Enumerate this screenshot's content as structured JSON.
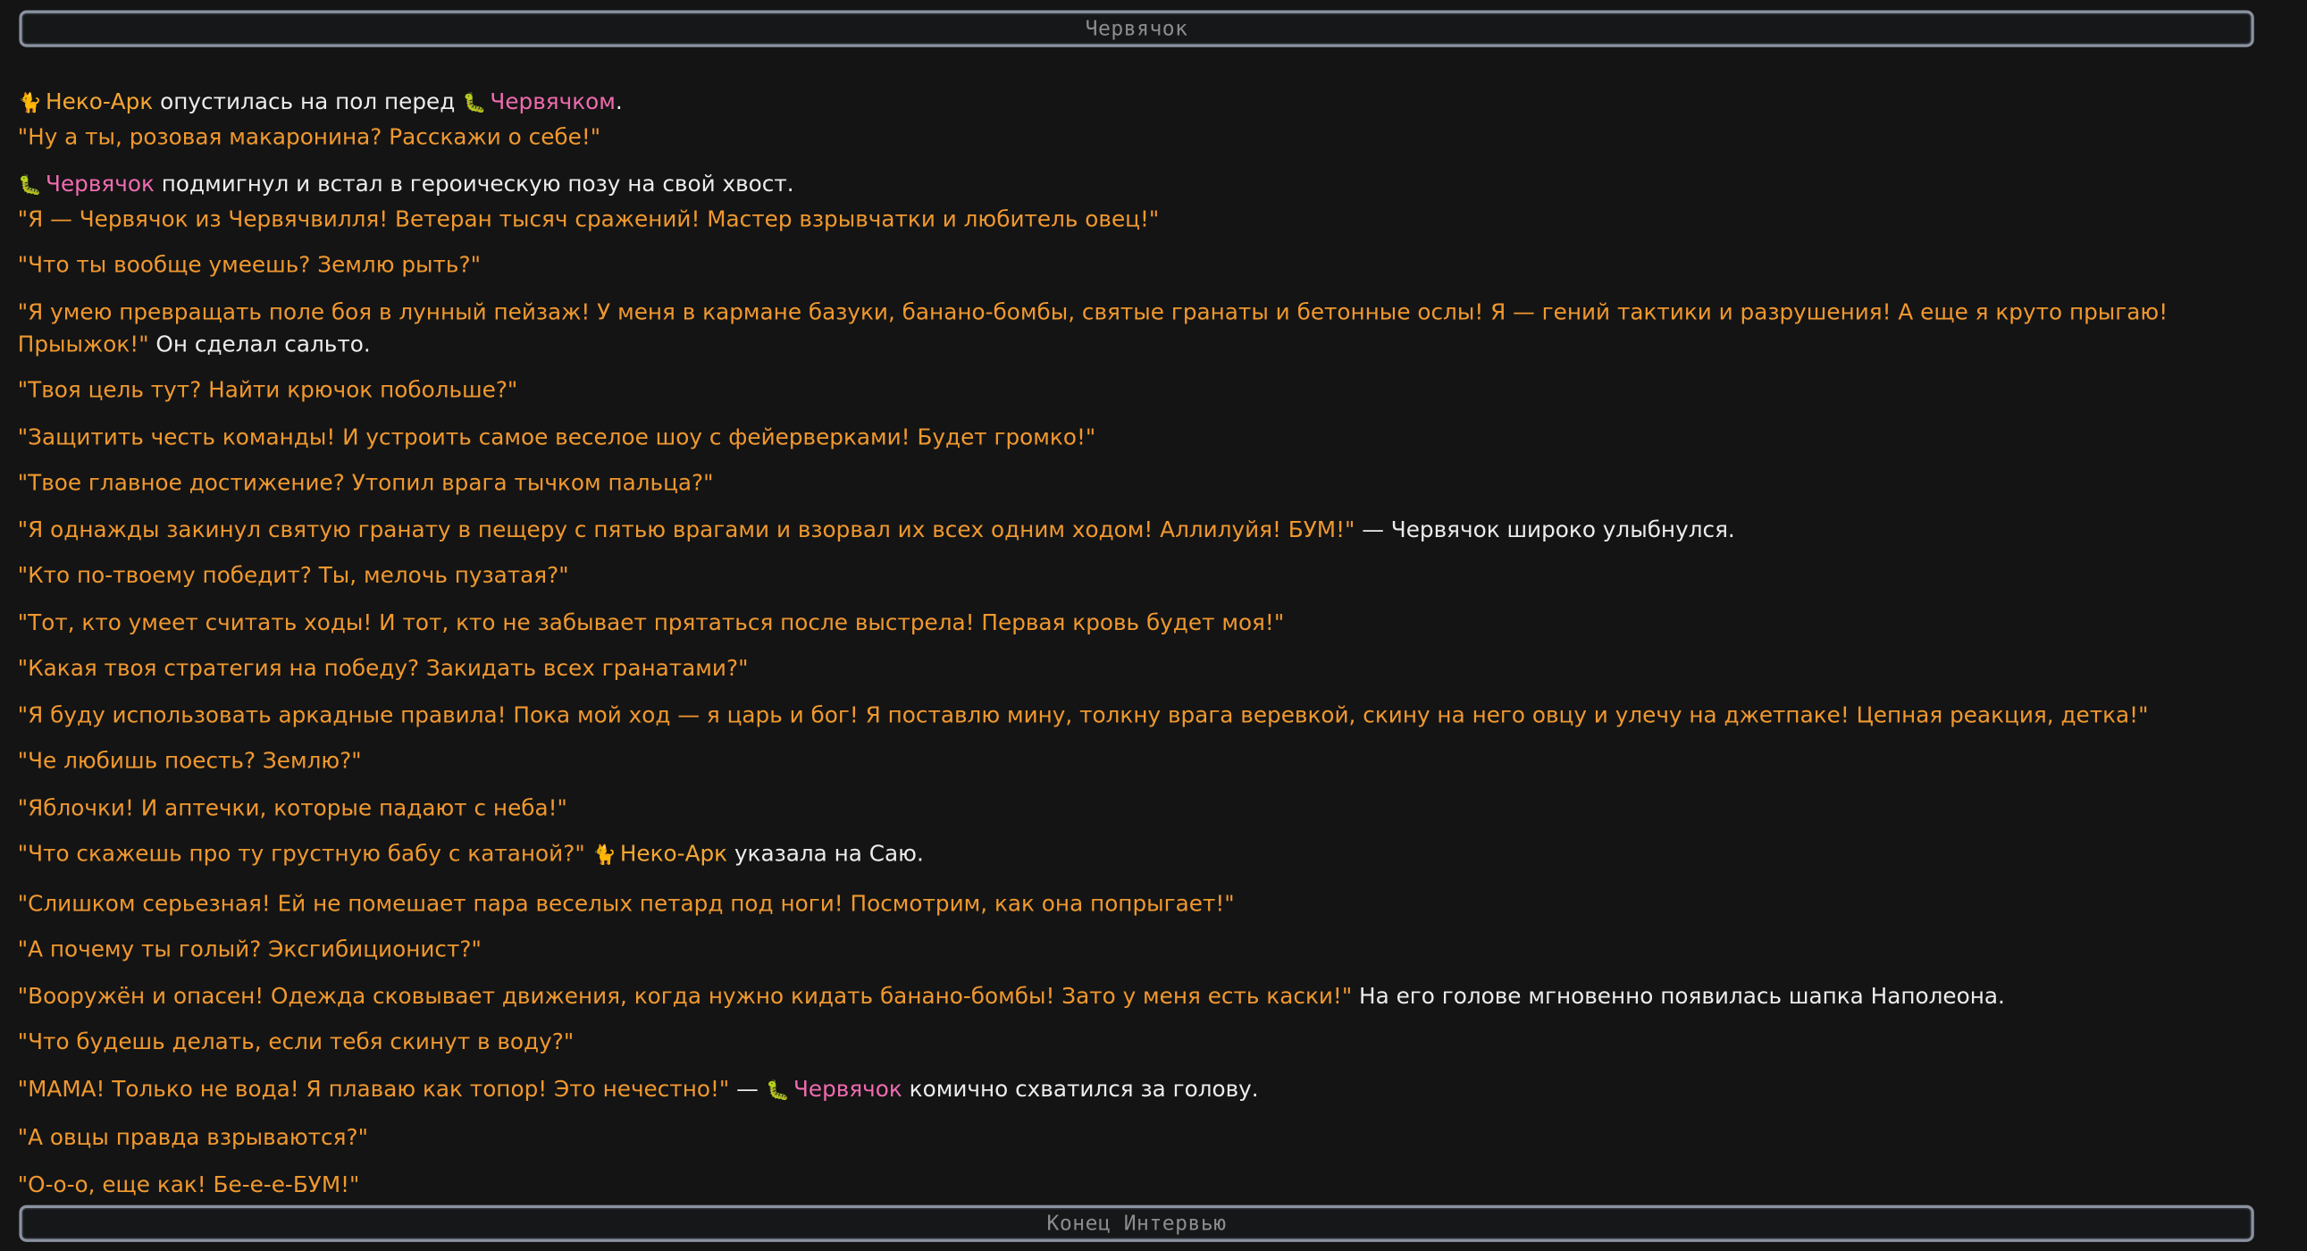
{
  "header": {
    "title": "Червячок"
  },
  "footer": {
    "title": "Конец Интервью"
  },
  "colors": {
    "background": "#141414",
    "quote": "#f0982f",
    "narration": "#ececec",
    "neko_name": "#f5a733",
    "worm_name": "#ef6bb0",
    "banner_border": "#8a92a0"
  },
  "icons": {
    "neko": "cat-icon",
    "worm": "worm-icon"
  },
  "p1": {
    "neko": "Неко-Арк",
    "t1": " опустилась на пол перед ",
    "worm": "Червячком",
    "t2": ".",
    "q1": "\"Ну а ты, розовая макаронина? Расскажи о себе!\""
  },
  "p2": {
    "worm": "Червячок",
    "t1": " подмигнул и встал в героическую позу на свой хвост.",
    "q1": "\"Я — Червячок из Червячвилля! Ветеран тысяч сражений! Мастер взрывчатки и любитель овец!\""
  },
  "p3": {
    "q": "\"Что ты вообще умеешь? Землю рыть?\""
  },
  "p4": {
    "q": "\"Я умею превращать поле боя в лунный пейзаж! У меня в кармане базуки, банано-бомбы, святые гранаты и бетонные ослы! Я — гений тактики и разрушения! А еще я круто прыгаю! Прыыжок!\"",
    "t": " Он сделал сальто."
  },
  "p5": {
    "q": "\"Твоя цель тут? Найти крючок побольше?\""
  },
  "p6": {
    "q": "\"Защитить честь команды! И устроить самое веселое шоу с фейерверками! Будет громко!\""
  },
  "p7": {
    "q": "\"Твое главное достижение? Утопил врага тычком пальца?\""
  },
  "p8": {
    "q": "\"Я однажды закинул святую гранату в пещеру с пятью врагами и взорвал их всех одним ходом! Аллилуйя! БУМ!\"",
    "t": " — Червячок широко улыбнулся."
  },
  "p9": {
    "q": "\"Кто по-твоему победит? Ты, мелочь пузатая?\""
  },
  "p10": {
    "q": "\"Тот, кто умеет считать ходы! И тот, кто не забывает прятаться после выстрела! Первая кровь будет моя!\""
  },
  "p11": {
    "q": "\"Какая твоя стратегия на победу? Закидать всех гранатами?\""
  },
  "p12": {
    "q": "\"Я буду использовать аркадные правила! Пока мой ход — я царь и бог! Я поставлю мину, толкну врага веревкой, скину на него овцу и улечу на джетпаке! Цепная реакция, детка!\""
  },
  "p13": {
    "q": "\"Че любишь поесть? Землю?\""
  },
  "p14": {
    "q": "\"Яблочки! И аптечки, которые падают с неба!\""
  },
  "p15": {
    "q": "\"Что скажешь про ту грустную бабу с катаной?\"",
    "neko": "Неко-Арк",
    "t": " указала на Саю."
  },
  "p16": {
    "q": "\"Слишком серьезная! Ей не помешает пара веселых петард под ноги! Посмотрим, как она попрыгает!\""
  },
  "p17": {
    "q": "\"А почему ты голый? Эксгибиционист?\""
  },
  "p18": {
    "q": "\"Вооружён и опасен! Одежда сковывает движения, когда нужно кидать банано-бомбы! Зато у меня есть каски!\"",
    "t": " На его голове мгновенно появилась шапка Наполеона."
  },
  "p19": {
    "q": "\"Что будешь делать, если тебя скинут в воду?\""
  },
  "p20": {
    "q": "\"МАМА! Только не вода! Я плаваю как топор! Это нечестно!\"",
    "t0": " — ",
    "worm": "Червячок",
    "t": " комично схватился за голову."
  },
  "p21": {
    "q": "\"А овцы правда взрываются?\""
  },
  "p22": {
    "q": "\"О-о-о, еще как! Бе-е-е-БУМ!\""
  }
}
